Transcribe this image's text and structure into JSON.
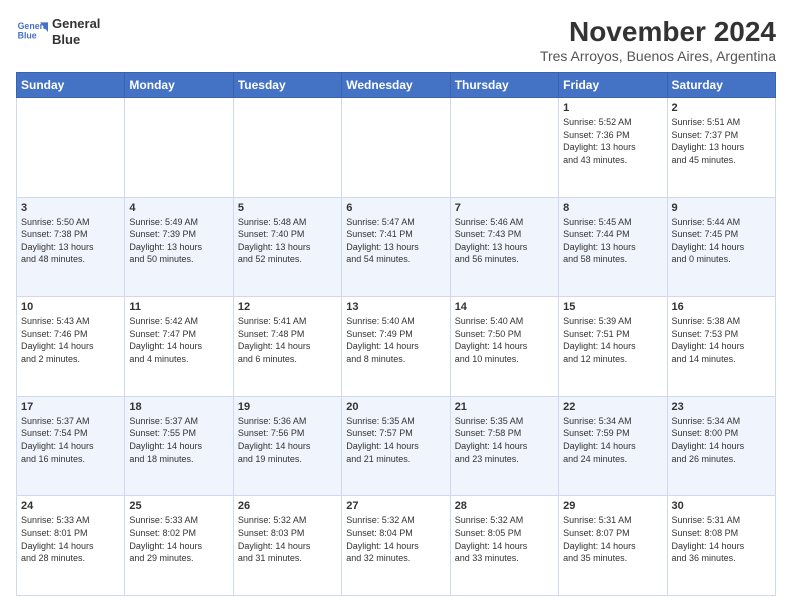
{
  "header": {
    "logo_line1": "General",
    "logo_line2": "Blue",
    "title": "November 2024",
    "subtitle": "Tres Arroyos, Buenos Aires, Argentina"
  },
  "columns": [
    "Sunday",
    "Monday",
    "Tuesday",
    "Wednesday",
    "Thursday",
    "Friday",
    "Saturday"
  ],
  "weeks": [
    [
      {
        "day": "",
        "info": ""
      },
      {
        "day": "",
        "info": ""
      },
      {
        "day": "",
        "info": ""
      },
      {
        "day": "",
        "info": ""
      },
      {
        "day": "",
        "info": ""
      },
      {
        "day": "1",
        "info": "Sunrise: 5:52 AM\nSunset: 7:36 PM\nDaylight: 13 hours\nand 43 minutes."
      },
      {
        "day": "2",
        "info": "Sunrise: 5:51 AM\nSunset: 7:37 PM\nDaylight: 13 hours\nand 45 minutes."
      }
    ],
    [
      {
        "day": "3",
        "info": "Sunrise: 5:50 AM\nSunset: 7:38 PM\nDaylight: 13 hours\nand 48 minutes."
      },
      {
        "day": "4",
        "info": "Sunrise: 5:49 AM\nSunset: 7:39 PM\nDaylight: 13 hours\nand 50 minutes."
      },
      {
        "day": "5",
        "info": "Sunrise: 5:48 AM\nSunset: 7:40 PM\nDaylight: 13 hours\nand 52 minutes."
      },
      {
        "day": "6",
        "info": "Sunrise: 5:47 AM\nSunset: 7:41 PM\nDaylight: 13 hours\nand 54 minutes."
      },
      {
        "day": "7",
        "info": "Sunrise: 5:46 AM\nSunset: 7:43 PM\nDaylight: 13 hours\nand 56 minutes."
      },
      {
        "day": "8",
        "info": "Sunrise: 5:45 AM\nSunset: 7:44 PM\nDaylight: 13 hours\nand 58 minutes."
      },
      {
        "day": "9",
        "info": "Sunrise: 5:44 AM\nSunset: 7:45 PM\nDaylight: 14 hours\nand 0 minutes."
      }
    ],
    [
      {
        "day": "10",
        "info": "Sunrise: 5:43 AM\nSunset: 7:46 PM\nDaylight: 14 hours\nand 2 minutes."
      },
      {
        "day": "11",
        "info": "Sunrise: 5:42 AM\nSunset: 7:47 PM\nDaylight: 14 hours\nand 4 minutes."
      },
      {
        "day": "12",
        "info": "Sunrise: 5:41 AM\nSunset: 7:48 PM\nDaylight: 14 hours\nand 6 minutes."
      },
      {
        "day": "13",
        "info": "Sunrise: 5:40 AM\nSunset: 7:49 PM\nDaylight: 14 hours\nand 8 minutes."
      },
      {
        "day": "14",
        "info": "Sunrise: 5:40 AM\nSunset: 7:50 PM\nDaylight: 14 hours\nand 10 minutes."
      },
      {
        "day": "15",
        "info": "Sunrise: 5:39 AM\nSunset: 7:51 PM\nDaylight: 14 hours\nand 12 minutes."
      },
      {
        "day": "16",
        "info": "Sunrise: 5:38 AM\nSunset: 7:53 PM\nDaylight: 14 hours\nand 14 minutes."
      }
    ],
    [
      {
        "day": "17",
        "info": "Sunrise: 5:37 AM\nSunset: 7:54 PM\nDaylight: 14 hours\nand 16 minutes."
      },
      {
        "day": "18",
        "info": "Sunrise: 5:37 AM\nSunset: 7:55 PM\nDaylight: 14 hours\nand 18 minutes."
      },
      {
        "day": "19",
        "info": "Sunrise: 5:36 AM\nSunset: 7:56 PM\nDaylight: 14 hours\nand 19 minutes."
      },
      {
        "day": "20",
        "info": "Sunrise: 5:35 AM\nSunset: 7:57 PM\nDaylight: 14 hours\nand 21 minutes."
      },
      {
        "day": "21",
        "info": "Sunrise: 5:35 AM\nSunset: 7:58 PM\nDaylight: 14 hours\nand 23 minutes."
      },
      {
        "day": "22",
        "info": "Sunrise: 5:34 AM\nSunset: 7:59 PM\nDaylight: 14 hours\nand 24 minutes."
      },
      {
        "day": "23",
        "info": "Sunrise: 5:34 AM\nSunset: 8:00 PM\nDaylight: 14 hours\nand 26 minutes."
      }
    ],
    [
      {
        "day": "24",
        "info": "Sunrise: 5:33 AM\nSunset: 8:01 PM\nDaylight: 14 hours\nand 28 minutes."
      },
      {
        "day": "25",
        "info": "Sunrise: 5:33 AM\nSunset: 8:02 PM\nDaylight: 14 hours\nand 29 minutes."
      },
      {
        "day": "26",
        "info": "Sunrise: 5:32 AM\nSunset: 8:03 PM\nDaylight: 14 hours\nand 31 minutes."
      },
      {
        "day": "27",
        "info": "Sunrise: 5:32 AM\nSunset: 8:04 PM\nDaylight: 14 hours\nand 32 minutes."
      },
      {
        "day": "28",
        "info": "Sunrise: 5:32 AM\nSunset: 8:05 PM\nDaylight: 14 hours\nand 33 minutes."
      },
      {
        "day": "29",
        "info": "Sunrise: 5:31 AM\nSunset: 8:07 PM\nDaylight: 14 hours\nand 35 minutes."
      },
      {
        "day": "30",
        "info": "Sunrise: 5:31 AM\nSunset: 8:08 PM\nDaylight: 14 hours\nand 36 minutes."
      }
    ]
  ]
}
